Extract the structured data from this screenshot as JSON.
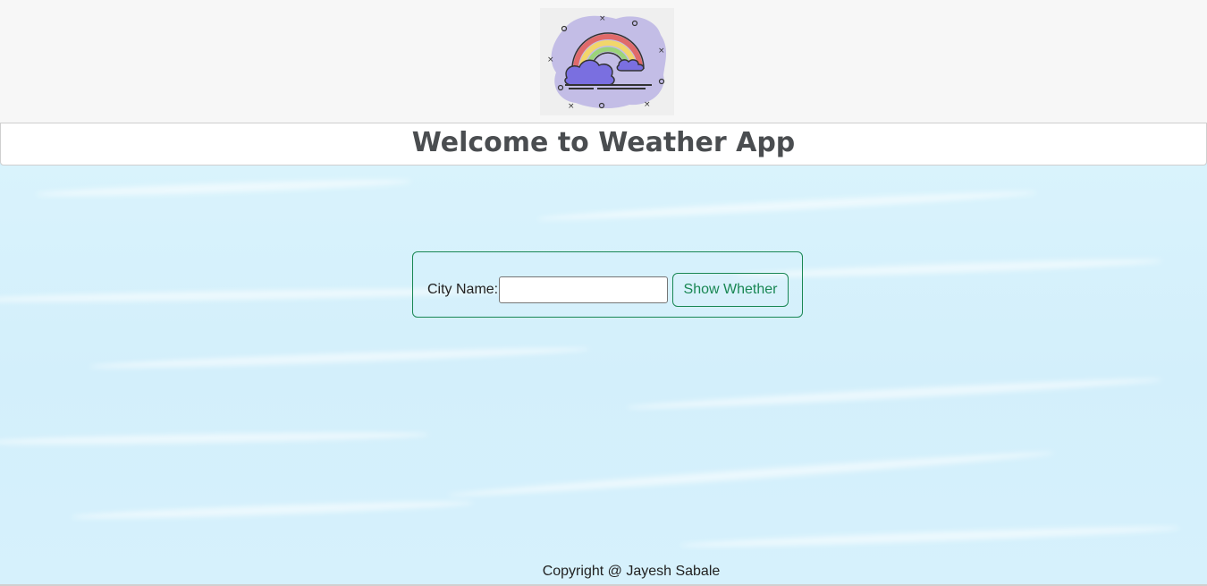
{
  "header": {
    "logo_icon": "rainbow-cloud-icon",
    "title": "Welcome to Weather App"
  },
  "search": {
    "label": "City Name:",
    "input_value": "",
    "button_label": "Show Whether"
  },
  "footer": {
    "copyright": "Copyright @ Jayesh Sabale"
  },
  "colors": {
    "accent": "#198754",
    "background": "#d4f0fb",
    "title_text": "#4a4d50"
  }
}
